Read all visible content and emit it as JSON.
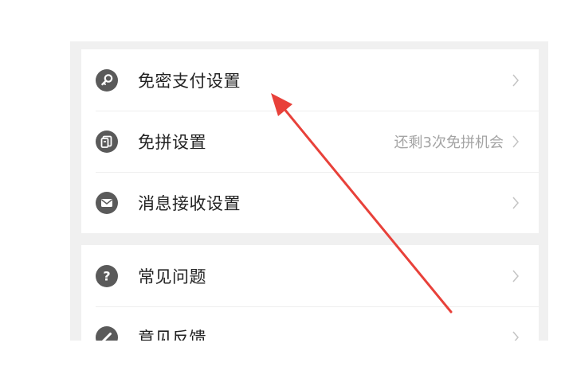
{
  "colors": {
    "icon_bg": "#5a5a5a",
    "text": "#222222",
    "hint_text": "#a4a4a4",
    "chevron": "#c4c4c4",
    "annotation_arrow": "#e8413a",
    "section_bg": "#f0f0f0"
  },
  "settings_group_1": [
    {
      "label": "免密支付设置",
      "hint": "",
      "icon": "key-icon"
    },
    {
      "label": "免拼设置",
      "hint": "还剩3次免拼机会",
      "icon": "card-icon"
    },
    {
      "label": "消息接收设置",
      "hint": "",
      "icon": "mail-icon"
    }
  ],
  "settings_group_2": [
    {
      "label": "常见问题",
      "hint": "",
      "icon": "question-icon"
    },
    {
      "label": "意见反馈",
      "hint": "",
      "icon": "pencil-icon"
    }
  ]
}
